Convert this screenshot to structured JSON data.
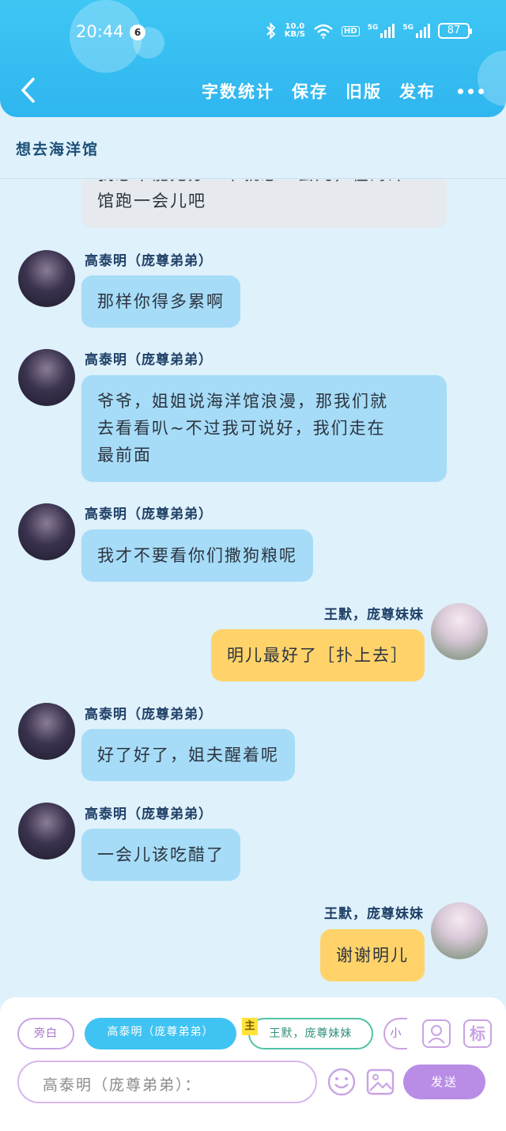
{
  "status_bar": {
    "time": "20:44",
    "notification_count": "6",
    "net_speed_value": "10.0",
    "net_speed_unit": "KB/S",
    "hd_label": "HD",
    "sim1_label": "5G",
    "sim2_label": "5G",
    "battery": "87"
  },
  "toolbar": {
    "word_count": "字数统计",
    "save": "保存",
    "old_version": "旧版",
    "publish": "发布"
  },
  "story_title": "想去海洋馆",
  "messages": [
    {
      "side": "left",
      "speaker": "",
      "text_line1": "我想不能无办一半就想一会儿，在海洋",
      "text_line2": "馆跑一会儿吧"
    },
    {
      "side": "left",
      "speaker": "高泰明（庞尊弟弟）",
      "text": "那样你得多累啊"
    },
    {
      "side": "left",
      "speaker": "高泰明（庞尊弟弟）",
      "text_line1": "爷爷，姐姐说海洋馆浪漫，那我们就",
      "text_line2": "去看看叭~不过我可说好，我们走在",
      "text_line3": "最前面"
    },
    {
      "side": "left",
      "speaker": "高泰明（庞尊弟弟）",
      "text": "我才不要看你们撒狗粮呢"
    },
    {
      "side": "right",
      "speaker": "王默，庞尊妹妹",
      "text": "明儿最好了［扑上去］"
    },
    {
      "side": "left",
      "speaker": "高泰明（庞尊弟弟）",
      "text": "好了好了，姐夫醒着呢"
    },
    {
      "side": "left",
      "speaker": "高泰明（庞尊弟弟）",
      "text": "一会儿该吃醋了"
    },
    {
      "side": "right",
      "speaker": "王默，庞尊妹妹",
      "text": "谢谢明儿"
    }
  ],
  "composer": {
    "chip_aside": "旁白",
    "chip_active": "高泰明（庞尊弟弟）",
    "main_tag": "主",
    "chip_wang": "王默，庞尊妹妹",
    "chip_small": "小",
    "tag_icon_label": "标",
    "input_placeholder": "高泰明（庞尊弟弟）：",
    "send": "发送"
  },
  "colors": {
    "header": "#3ec6f4",
    "bubble_left": "#a6dcf7",
    "bubble_right": "#ffd36a",
    "send_button": "#b98de6"
  }
}
